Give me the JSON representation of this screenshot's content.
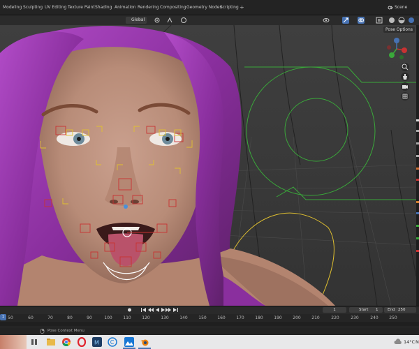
{
  "workspace_tabs": [
    "Modeling",
    "Sculpting",
    "UV Editing",
    "Texture Paint",
    "Shading",
    "Animation",
    "Rendering",
    "Compositing",
    "Geometry Nodes",
    "Scripting"
  ],
  "add_tab": "+",
  "scene_name": "Scene",
  "viewport_header": {
    "orientation": "Global",
    "pose_options": "Pose Options"
  },
  "timeline": {
    "current_frame": "1",
    "start_label": "Start",
    "start_value": "1",
    "end_label": "End",
    "end_value": "250",
    "playhead": "1",
    "ruler_ticks": [
      "50",
      "60",
      "70",
      "80",
      "90",
      "100",
      "110",
      "120",
      "130",
      "140",
      "150",
      "160",
      "170",
      "180",
      "190",
      "200",
      "210",
      "220",
      "230",
      "240",
      "250"
    ]
  },
  "status_bar": {
    "context_menu": "Pose Context Menu"
  },
  "taskbar": {
    "temperature": "14°C",
    "extra": "N"
  },
  "colors": {
    "active_blue": "#4772b3",
    "bone_red": "#c83232",
    "bone_yellow": "#e0c030",
    "bone_green": "#3aa83a",
    "hair_purple": "#9a3fb0"
  },
  "icons": {
    "navigation": [
      "zoom-icon",
      "hand-pan-icon",
      "camera-icon",
      "grid-icon"
    ],
    "taskbar": [
      "explorer-icon",
      "chrome-icon",
      "opera-icon",
      "adobe-icon",
      "c-icon",
      "photos-icon",
      "blender-icon"
    ]
  }
}
